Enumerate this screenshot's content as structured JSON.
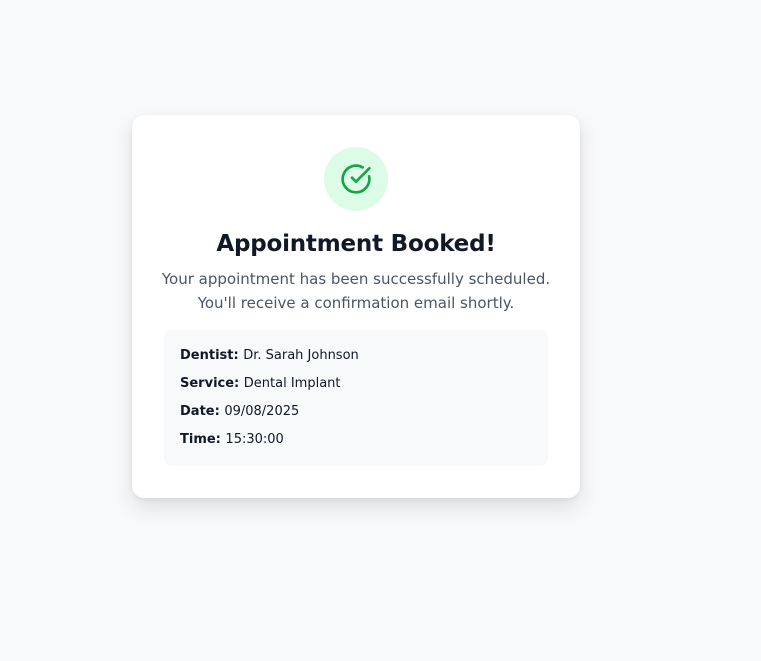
{
  "confirmation": {
    "icon": "check-circle-icon",
    "accent_color": "#16a34a",
    "icon_bg_color": "#dcfce7",
    "title": "Appointment Booked!",
    "message_line1": "Your appointment has been successfully scheduled.",
    "message_line2": "You'll receive a confirmation email shortly."
  },
  "details": [
    {
      "label": "Dentist:",
      "value": "Dr. Sarah Johnson"
    },
    {
      "label": "Service:",
      "value": "Dental Implant"
    },
    {
      "label": "Date:",
      "value": "09/08/2025"
    },
    {
      "label": "Time:",
      "value": "15:30:00"
    }
  ]
}
